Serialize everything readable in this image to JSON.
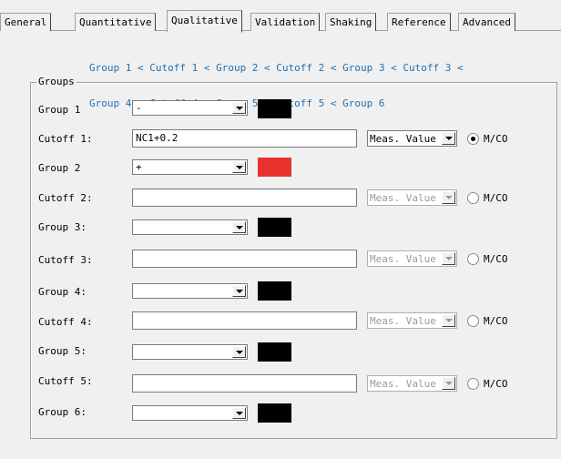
{
  "tabs": [
    {
      "label": "General",
      "active": false
    },
    {
      "label": "Quantitative",
      "active": false
    },
    {
      "label": "Qualitative",
      "active": true
    },
    {
      "label": "Validation",
      "active": false
    },
    {
      "label": "Shaking",
      "active": false
    },
    {
      "label": "Reference",
      "active": false
    },
    {
      "label": "Advanced",
      "active": false
    }
  ],
  "order_line1": "Group 1 < Cutoff 1 < Group 2 < Cutoff 2 < Group 3 < Cutoff 3 <",
  "order_line2": "Group 4 < Cutoff 4 < Group 5 < Cutoff 5 < Group 6",
  "groups_title": "Groups",
  "groups": [
    {
      "label": "Group 1",
      "value": "-",
      "color": "#000000"
    },
    {
      "label": "Group 2",
      "value": "+",
      "color": "#e8322e"
    },
    {
      "label": "Group 3:",
      "value": "",
      "color": "#000000"
    },
    {
      "label": "Group 4:",
      "value": "",
      "color": "#000000"
    },
    {
      "label": "Group 5:",
      "value": "",
      "color": "#000000"
    },
    {
      "label": "Group 6:",
      "value": "",
      "color": "#000000"
    }
  ],
  "cutoffs": [
    {
      "label": "Cutoff 1:",
      "value": "NC1+0.2",
      "meas": "Meas. Value",
      "mode": "M/CO",
      "enabled": true,
      "checked": true
    },
    {
      "label": "Cutoff 2:",
      "value": "",
      "meas": "Meas. Value",
      "mode": "M/CO",
      "enabled": false,
      "checked": false
    },
    {
      "label": "Cutoff 3:",
      "value": "",
      "meas": "Meas. Value",
      "mode": "M/CO",
      "enabled": false,
      "checked": false
    },
    {
      "label": "Cutoff 4:",
      "value": "",
      "meas": "Meas. Value",
      "mode": "M/CO",
      "enabled": false,
      "checked": false
    },
    {
      "label": "Cutoff 5:",
      "value": "",
      "meas": "Meas. Value",
      "mode": "M/CO",
      "enabled": false,
      "checked": false
    }
  ]
}
